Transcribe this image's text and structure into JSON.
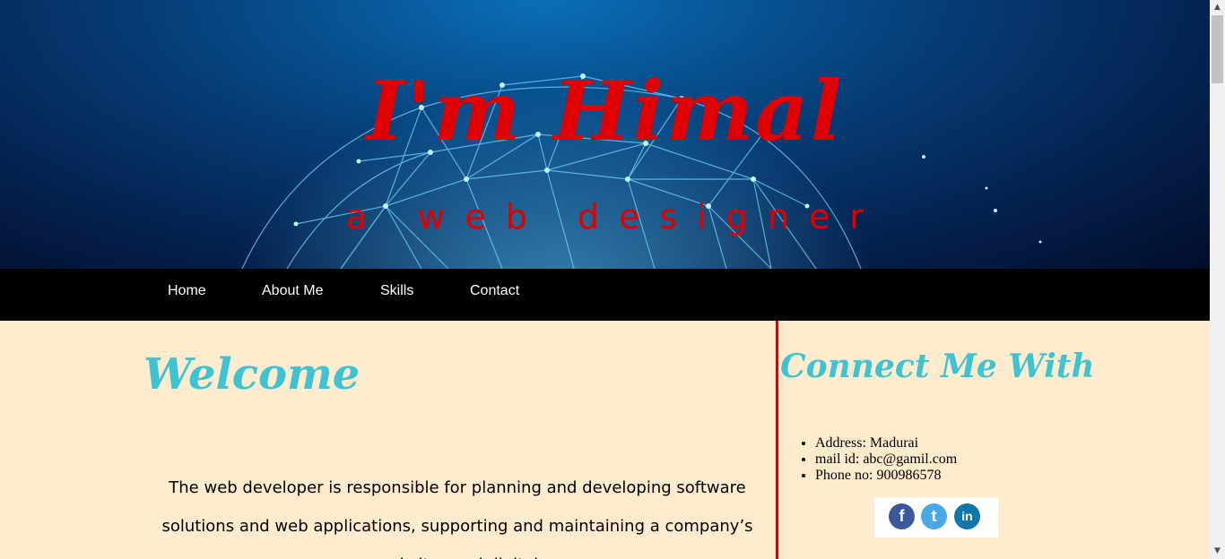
{
  "hero": {
    "title": "I'm Himal",
    "subtitle": "a web designer"
  },
  "nav": {
    "items": [
      "Home",
      "About Me",
      "Skills",
      "Contact"
    ]
  },
  "main": {
    "welcome_heading": "Welcome",
    "intro_text": "The web developer is responsible for planning and developing software solutions and web applications, supporting and maintaining a company’s websites and digital"
  },
  "sidebar": {
    "connect_heading": "Connect Me With",
    "contacts": [
      "Address:   Madurai",
      "mail   id:   abc@gamil.com",
      "Phone   no:   900986578"
    ],
    "social": [
      {
        "icon": "facebook-icon",
        "glyph": "f",
        "color": "#3b5998"
      },
      {
        "icon": "twitter-icon",
        "glyph": "t",
        "color": "#4aa8e6"
      },
      {
        "icon": "linkedin-icon",
        "glyph": "in",
        "color": "#0e76a8"
      }
    ]
  },
  "colors": {
    "accent_red": "#e00000",
    "heading_teal": "#3fc3d3",
    "content_bg": "#ffebcd",
    "nav_bg": "#000000"
  }
}
